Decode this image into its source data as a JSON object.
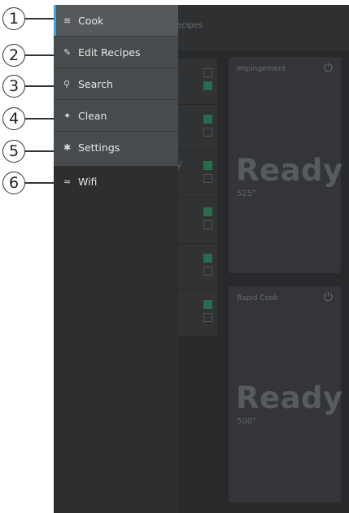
{
  "callouts": [
    "1",
    "2",
    "3",
    "4",
    "5",
    "6"
  ],
  "menu": {
    "items": [
      {
        "label": "Cook",
        "icon": "≋",
        "active": true
      },
      {
        "label": "Edit Recipes",
        "icon": "✎"
      },
      {
        "label": "Search",
        "icon": "⚲"
      },
      {
        "label": "Clean",
        "icon": "✦"
      },
      {
        "label": "Settings",
        "icon": "✱"
      }
    ],
    "wifi": {
      "label": "Wifi",
      "icon": "≈"
    }
  },
  "background": {
    "header_text": "ecipes",
    "list_fragment": "y",
    "ovens": [
      {
        "name": "Impingement",
        "status": "Ready",
        "temp": "525°"
      },
      {
        "name": "Rapid Cook",
        "status": "Ready",
        "temp": "500°"
      }
    ],
    "toggles": [
      {
        "top": false,
        "bottom": true
      },
      {
        "top": true,
        "bottom": false
      },
      {
        "top": true,
        "bottom": false
      },
      {
        "top": true,
        "bottom": false
      },
      {
        "top": true,
        "bottom": false
      },
      {
        "top": true,
        "bottom": false
      }
    ]
  }
}
